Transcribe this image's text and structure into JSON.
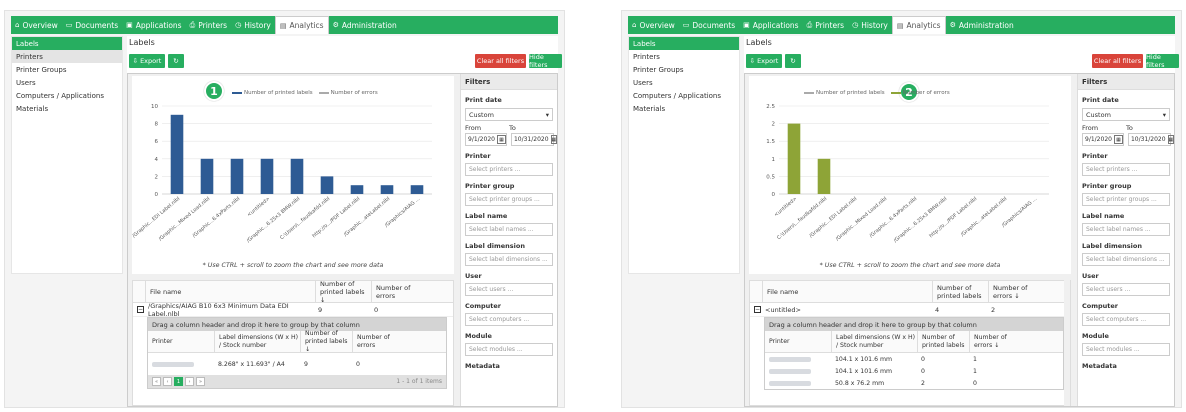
{
  "nav": {
    "items": [
      {
        "label": "Overview",
        "icon": "home-icon"
      },
      {
        "label": "Documents",
        "icon": "documents-icon"
      },
      {
        "label": "Applications",
        "icon": "applications-icon"
      },
      {
        "label": "Printers",
        "icon": "printers-icon"
      },
      {
        "label": "History",
        "icon": "history-icon"
      },
      {
        "label": "Analytics",
        "icon": "analytics-icon"
      },
      {
        "label": "Administration",
        "icon": "administration-icon"
      }
    ],
    "active": "Analytics",
    "colors": {
      "bar": "#27ae60",
      "text": "#ffffff"
    }
  },
  "sidebar": {
    "items": [
      "Labels",
      "Printers",
      "Printer Groups",
      "Users",
      "Computers / Applications",
      "Materials"
    ]
  },
  "page_title": "Labels",
  "toolbar": {
    "export_label": "Export",
    "clear_label": "Clear all filters",
    "hide_label": "Hide filters"
  },
  "filters": {
    "title": "Filters",
    "print_date_label": "Print date",
    "print_date_value": "Custom",
    "from_label": "From",
    "to_label": "To",
    "from_value": "9/1/2020",
    "to_value": "10/31/2020",
    "printer_label": "Printer",
    "printer_placeholder": "Select printers ...",
    "printer_group_label": "Printer group",
    "printer_group_placeholder": "Select printer groups ...",
    "label_name_label": "Label name",
    "label_name_placeholder": "Select label names ...",
    "label_dimension_label": "Label dimension",
    "label_dimension_placeholder": "Select label dimensions ...",
    "user_label": "User",
    "user_placeholder": "Select users ...",
    "computer_label": "Computer",
    "computer_placeholder": "Select computers ...",
    "module_label": "Module",
    "module_placeholder": "Select modules ...",
    "metadata_label": "Metadata"
  },
  "chart_hint": "* Use CTRL + scroll to zoom the chart and see more data",
  "panel1": {
    "badge": "1",
    "grid": {
      "col_file": "File name",
      "col_printed": "Number of printed labels ↓",
      "col_errors": "Number of errors",
      "row": {
        "file": "/Graphics/AIAG B10 6x3 Minimum Data EDI Label.nlbl",
        "printed": "9",
        "errors": "0"
      },
      "group_hint": "Drag a column header and drop it here to group by that column",
      "sub_cols": [
        "Printer",
        "Label dimensions (W x H) / Stock number",
        "Number of printed labels ↓",
        "Number of errors"
      ],
      "sub_row": {
        "dims": "8.268\" x 11.693\" / A4",
        "printed": "9",
        "errors": "0"
      },
      "pager_page": "1",
      "pager_info": "1 - 1 of 1 items"
    }
  },
  "panel2": {
    "badge": "2",
    "grid": {
      "col_file": "File name",
      "col_printed": "Number of printed labels",
      "col_errors": "Number of errors ↓",
      "row": {
        "file": "<untitled>",
        "printed": "4",
        "errors": "2"
      },
      "group_hint": "Drag a column header and drop it here to group by that column",
      "sub_cols": [
        "Printer",
        "Label dimensions (W x H) / Stock number",
        "Number of printed labels",
        "Number of errors ↓"
      ],
      "sub_rows": [
        {
          "dims": "104.1 x 101.6 mm",
          "printed": "0",
          "errors": "1"
        },
        {
          "dims": "104.1 x 101.6 mm",
          "printed": "0",
          "errors": "1"
        },
        {
          "dims": "50.8 x 76.2 mm",
          "printed": "2",
          "errors": "0"
        }
      ]
    }
  },
  "chart_data": [
    {
      "type": "bar",
      "legend": [
        "Number of printed labels",
        "Number of errors"
      ],
      "highlight": "Number of printed labels",
      "color": "#2e5b94",
      "categories": [
        "/Graphic...EDI Label.nlbl",
        "/Graphic...Mixed Load.nlbl",
        "/Graphic...6.4xParts.nlbl",
        "<untitled>",
        "/Graphic...6.25x3 BMW.nlbl",
        "C:\\Users\\...faudkafdd.nlbl",
        "http://o.../PDF Label.nlbl",
        "/Graphic...ateLabel.nlbl",
        "/Graphics/AIAG ..."
      ],
      "values": [
        9,
        4,
        4,
        4,
        4,
        2,
        1,
        1,
        1
      ],
      "yticks": [
        0,
        2,
        4,
        6,
        8,
        10
      ],
      "ylim": [
        0,
        10
      ]
    },
    {
      "type": "bar",
      "legend": [
        "Number of printed labels",
        "Number of errors"
      ],
      "highlight": "Number of errors",
      "color": "#8ea437",
      "categories": [
        "<untitled>",
        "C:\\Users\\...faudkafdd.nlbl",
        "/Graphic...EDI Label.nlbl",
        "/Graphic...Mixed Load.nlbl",
        "/Graphic...6.4xParts.nlbl",
        "/Graphic...6.25x3 BMW.nlbl",
        "http://o.../PDF Label.nlbl",
        "/Graphic...ateLabel.nlbl",
        "/Graphics/AIAG ..."
      ],
      "values": [
        2,
        1,
        0,
        0,
        0,
        0,
        0,
        0,
        0
      ],
      "yticks": [
        0,
        0.5,
        1,
        1.5,
        2,
        2.5
      ],
      "ylim": [
        0,
        2.5
      ]
    }
  ]
}
